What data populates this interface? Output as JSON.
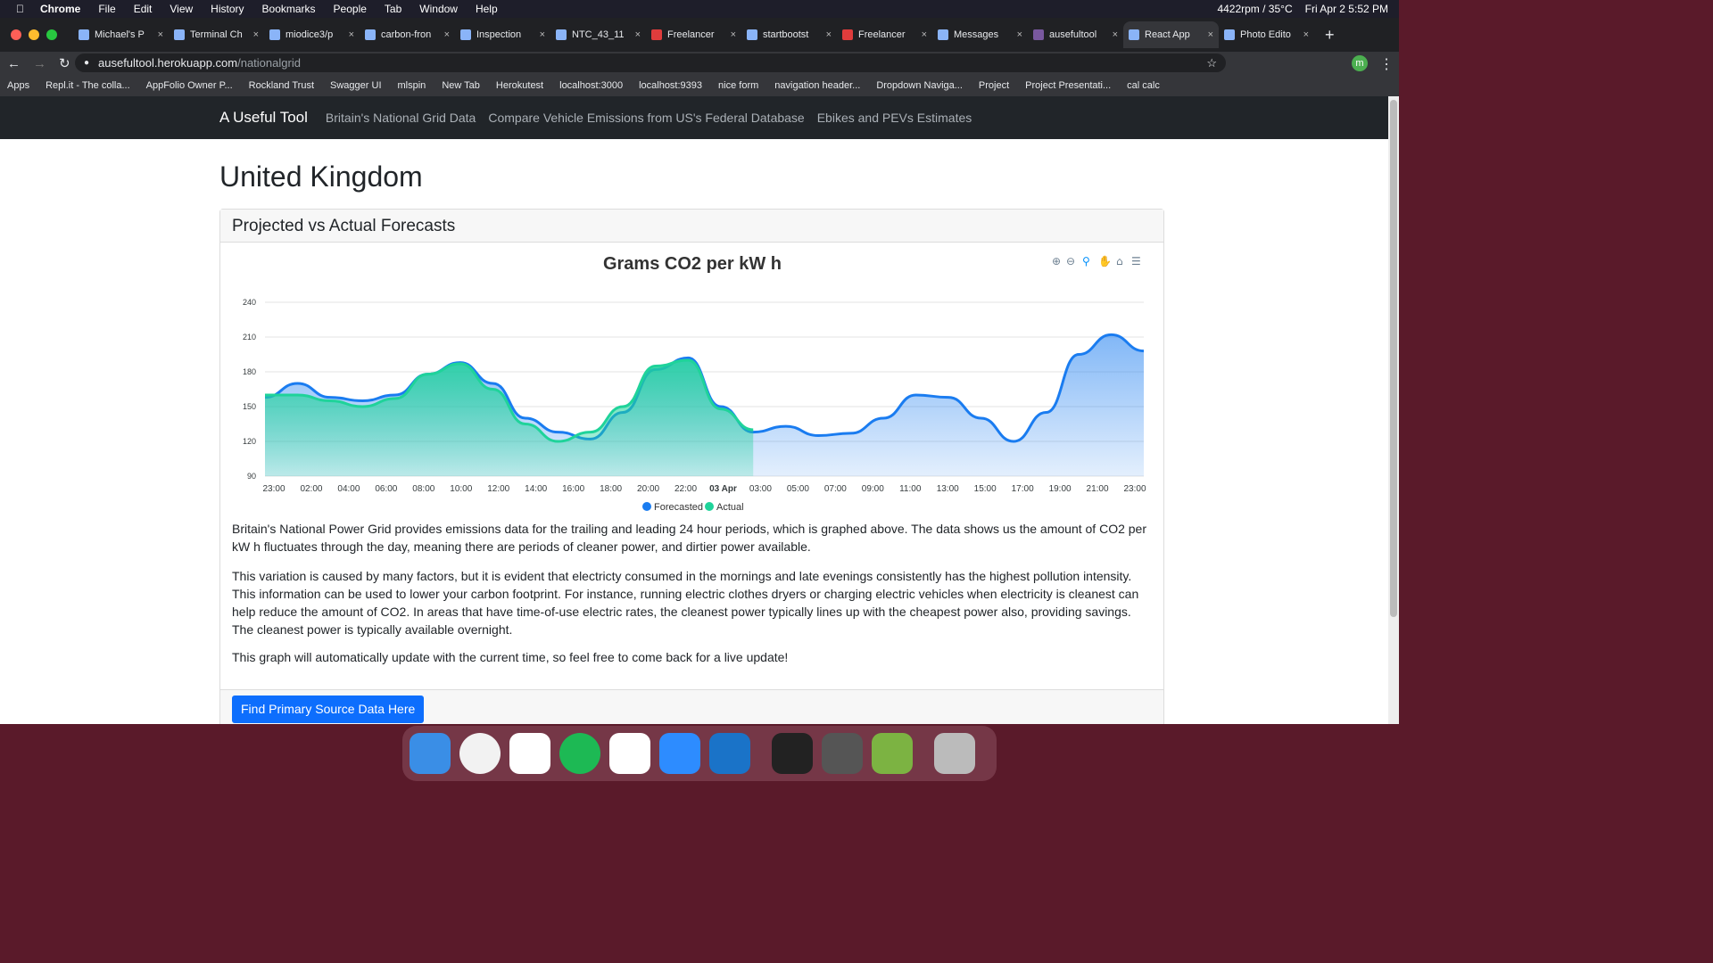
{
  "mac": {
    "apple": "",
    "app": "Chrome",
    "menus": [
      "File",
      "Edit",
      "View",
      "History",
      "Bookmarks",
      "People",
      "Tab",
      "Window",
      "Help"
    ],
    "status": "4422rpm / 35°C",
    "datetime": "Fri Apr 2  5:52 PM"
  },
  "tabs": [
    "Michael's P",
    "Terminal Ch",
    "miodice3/p",
    "carbon-fron",
    "Inspection",
    "NTC_43_11",
    "Freelancer",
    "startbootst",
    "Freelancer",
    "Messages",
    "ausefultool",
    "React App",
    "Photo Edito"
  ],
  "url": {
    "host": "ausefultool.herokuapp.com",
    "path": "/nationalgrid"
  },
  "bookmarks": [
    "Apps",
    "Repl.it - The colla...",
    "AppFolio Owner P...",
    "Rockland Trust",
    "Swagger UI",
    "mlspin",
    "New Tab",
    "Herokutest",
    "localhost:3000",
    "localhost:9393",
    "nice form",
    "navigation header...",
    "Dropdown Naviga...",
    "Project",
    "Project Presentati...",
    "cal calc"
  ],
  "nav": {
    "brand": "A Useful Tool",
    "links": [
      "Britain's National Grid Data",
      "Compare Vehicle Emissions from US's Federal Database",
      "Ebikes and PEVs Estimates"
    ]
  },
  "heading": "United Kingdom",
  "card": {
    "title": "Projected vs Actual Forecasts",
    "button": "Find Primary Source Data Here"
  },
  "paragraphs": [
    "Britain's National Power Grid provides emissions data for the trailing and leading 24 hour periods, which is graphed above. The data shows us the amount of CO2 per kW h fluctuates through the day, meaning there are periods of cleaner power, and dirtier power available.",
    "This variation is caused by many factors, but it is evident that electricty consumed in the mornings and late evenings consistently has the highest pollution intensity. This information can be used to lower your carbon footprint. For instance, running electric clothes dryers or charging electric vehicles when electricity is cleanest can help reduce the amount of CO2. In areas that have time-of-use electric rates, the cleanest power typically lines up with the cheapest power also, providing savings. The cleanest power is typically available overnight.",
    "This graph will automatically update with the current time, so feel free to come back for a live update!"
  ],
  "chart_data": {
    "type": "area",
    "title": "Grams CO2 per kW h",
    "ylim": [
      90,
      240
    ],
    "yticks": [
      90,
      120,
      150,
      180,
      210,
      240
    ],
    "xticks": [
      "23:00",
      "02:00",
      "04:00",
      "06:00",
      "08:00",
      "10:00",
      "12:00",
      "14:00",
      "16:00",
      "18:00",
      "20:00",
      "22:00",
      "03 Apr",
      "03:00",
      "05:00",
      "07:00",
      "09:00",
      "11:00",
      "13:00",
      "15:00",
      "17:00",
      "19:00",
      "21:00",
      "23:00"
    ],
    "series": [
      {
        "name": "Forecasted",
        "color": "#1a7cf0",
        "values": [
          158,
          170,
          158,
          155,
          160,
          178,
          188,
          170,
          140,
          128,
          122,
          145,
          182,
          192,
          150,
          128,
          133,
          125,
          127,
          140,
          160,
          158,
          140,
          120,
          145,
          195,
          212,
          198
        ]
      },
      {
        "name": "Actual",
        "color": "#1fd39a",
        "values": [
          160,
          160,
          155,
          150,
          157,
          178,
          187,
          165,
          135,
          120,
          128,
          150,
          185,
          190,
          148,
          130
        ]
      }
    ],
    "legend": "bottom"
  }
}
